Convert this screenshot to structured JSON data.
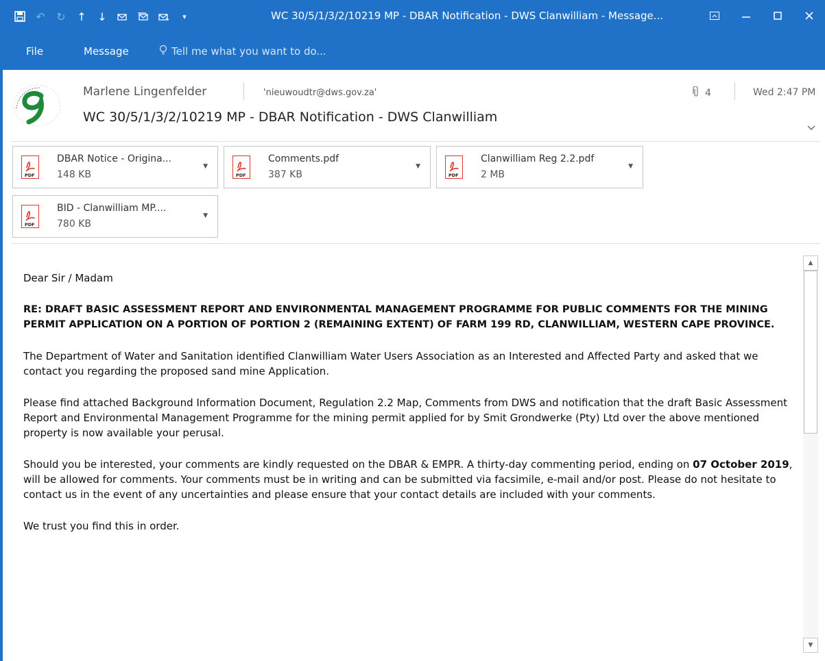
{
  "window": {
    "title": "WC 30/5/1/3/2/10219 MP - DBAR Notification - DWS Clanwilliam - Message...",
    "quick_access_icons": [
      "save-icon",
      "undo-icon",
      "redo-icon",
      "up-arrow-icon",
      "down-arrow-icon",
      "reply-icon",
      "reply-all-icon",
      "forward-icon",
      "customize-dropdown-icon"
    ]
  },
  "ribbon": {
    "tabs": [
      "File",
      "Message"
    ],
    "tell_me": "Tell me what you want to do..."
  },
  "message": {
    "sender": "Marlene Lingenfelder",
    "to": "'nieuwoudtr@dws.gov.za'",
    "attachment_count": "4",
    "date": "Wed 2:47 PM",
    "subject": "WC 30/5/1/3/2/10219 MP - DBAR Notification - DWS Clanwilliam"
  },
  "attachments": [
    {
      "name": "DBAR Notice - Origina...",
      "size": "148 KB"
    },
    {
      "name": "Comments.pdf",
      "size": "387 KB"
    },
    {
      "name": "Clanwilliam Reg 2.2.pdf",
      "size": "2 MB"
    },
    {
      "name": "BID - Clanwilliam MP....",
      "size": "780 KB"
    }
  ],
  "body": {
    "greeting": "Dear Sir / Madam",
    "re_heading": "RE: DRAFT BASIC ASSESSMENT REPORT AND ENVIRONMENTAL MANAGEMENT PROGRAMME FOR PUBLIC COMMENTS FOR THE MINING PERMIT APPLICATION ON A PORTION OF PORTION 2 (REMAINING EXTENT) OF FARM 199 RD, CLANWILLIAM, WESTERN CAPE PROVINCE.",
    "para1": "The Department of Water and Sanitation identified Clanwilliam Water Users Association as an Interested and Affected Party and asked that we contact you regarding the proposed sand mine Application.",
    "para2": "Please find attached Background Information Document, Regulation 2.2 Map, Comments from DWS and notification that the draft Basic Assessment Report and Environmental Management Programme for the mining permit applied for by Smit Grondwerke (Pty) Ltd over the above mentioned property is now available your perusal.",
    "para3_before": "Should you be interested, your comments are kindly requested on the DBAR & EMPR. A thirty-day commenting period, ending on ",
    "para3_bold": "07 October 2019",
    "para3_after": ", will be allowed for comments. Your comments must be in writing and can be submitted via facsimile, e-mail and/or post. Please do not hesitate to contact us in the event of any uncertainties and please ensure that your contact details are included with your comments.",
    "closing": "We trust you find this in order."
  },
  "colors": {
    "titlebar": "#1f72c8",
    "pdf_red": "#e0362b",
    "logo_green": "#1f8a3a"
  }
}
